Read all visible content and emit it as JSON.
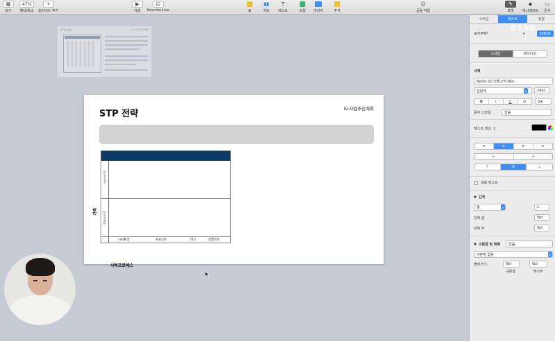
{
  "toolbar": {
    "view": "보기",
    "zoom_value": "47%",
    "zoom_label": "확대/축소",
    "add_slide": "슬라이드 추가",
    "play": "재생",
    "keynote_live": "Keynote Live",
    "table": "표",
    "chart": "차트",
    "text": "텍스트",
    "shape": "도형",
    "media": "미디어",
    "comment": "주석",
    "collaborate": "공동 작업",
    "format": "포맷",
    "animate": "애니메이트",
    "document": "문서"
  },
  "thumbnail": {
    "title": "STP 전략",
    "section": "IV. 사업추진계획"
  },
  "slide": {
    "title": "STP 전략",
    "section": "IV.사업추진계획",
    "table": {
      "row_labels": [
        "고부가가치",
        "저부가가치"
      ],
      "col_labels": [
        "사육환경",
        "자료공이",
        "번식",
        "질병이력"
      ],
      "y_axis_label": "가축",
      "x_axis_label": "사육프로세스"
    }
  },
  "inspector": {
    "tabs": [
      "스타일",
      "텍스트",
      "정렬"
    ],
    "paragraph_style": "표지부제*",
    "update_button": "업데이트",
    "style_tab": "스타일",
    "layout_tab": "레이아웃",
    "font_heading": "서체",
    "font_family": "Apple SD 산돌고딕 Neo",
    "font_weight": "일반체",
    "font_size": "24pt",
    "b": "B",
    "i": "I",
    "u": "U",
    "char_style_label": "문자 스타일",
    "char_style_value": "없음",
    "text_color_label": "텍스트 색상",
    "vertical_text": "세로 텍스트",
    "spacing_heading": "간격",
    "spacing_mode": "줄",
    "spacing_value": "1",
    "before_label": "단락 앞",
    "before_value": "0pt",
    "after_label": "단락 뒤",
    "after_value": "0pt",
    "bullets_heading": "구분점 및 목록",
    "bullets_value": "없음",
    "bullet_type": "구분점 없음",
    "indent_label": "들여쓰기:",
    "indent_bullet_value": "0pt",
    "indent_text_value": "0pt",
    "indent_bullet_caption": "구분점",
    "indent_text_caption": "텍스트",
    "watermark": "BEAR"
  },
  "colors": {
    "accent": "#3e8ef7",
    "table_header": "#0e3a66",
    "canvas": "#c6cbd3"
  }
}
